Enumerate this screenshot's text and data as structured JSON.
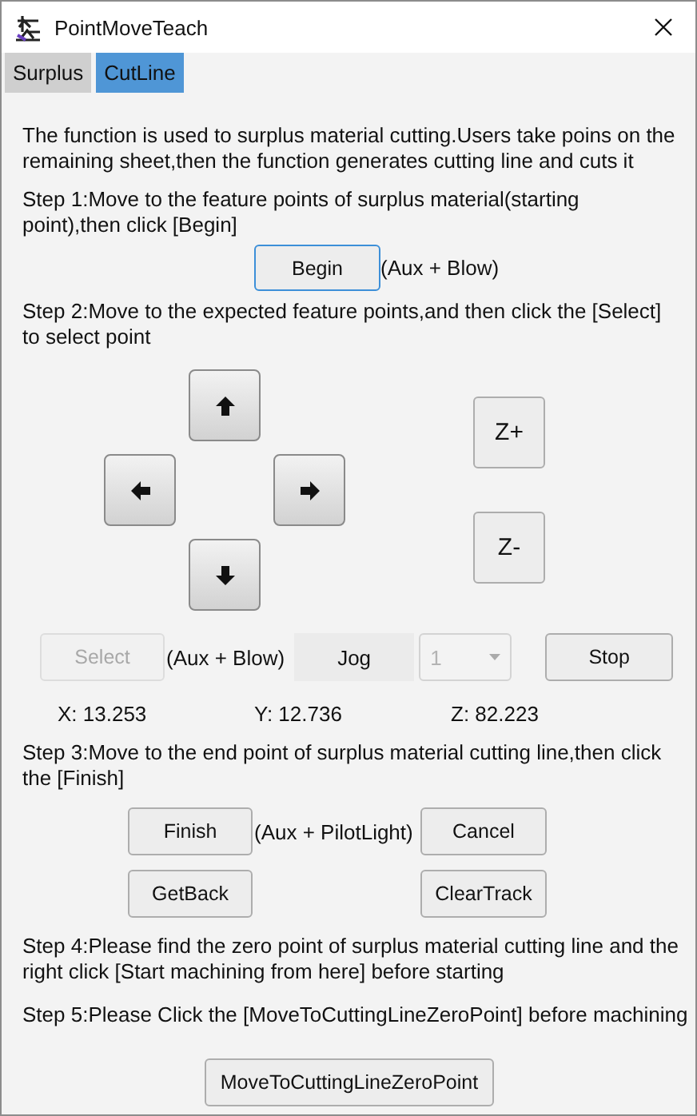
{
  "window": {
    "title": "PointMoveTeach"
  },
  "tabs": [
    {
      "label": "Surplus",
      "selected": false
    },
    {
      "label": "CutLine",
      "selected": true
    }
  ],
  "intro": "The function is used to surplus material cutting.Users take poins on the remaining sheet,then the function generates cutting line and cuts it",
  "step1": {
    "text": "Step 1:Move to the feature points of surplus material(starting point),then click [Begin]",
    "button": "Begin",
    "hint": "(Aux + Blow)"
  },
  "step2": {
    "text": "Step 2:Move to the expected feature points,and then click the [Select] to select point",
    "z_buttons": [
      "Z+",
      "Z-"
    ],
    "select": {
      "label": "Select",
      "disabled": true
    },
    "select_hint": "(Aux + Blow)",
    "jog": "Jog",
    "speed": {
      "value": "1",
      "disabled": true
    },
    "stop": "Stop"
  },
  "coordinates": [
    "X: 13.253",
    "Y: 12.736",
    "Z: 82.223"
  ],
  "step3": {
    "text": "Step 3:Move to the end point of surplus material cutting line,then click the [Finish]",
    "finish": "Finish",
    "hint": "(Aux + PilotLight)",
    "cancel": "Cancel",
    "get_back": "GetBack",
    "clear_track": "ClearTrack"
  },
  "step4": {
    "lines": [
      "Step 4:Please find the zero point of surplus material cutting line and the",
      "right click [Start machining from here] before starting"
    ]
  },
  "step5": "Step 5:Please Click the [MoveToCuttingLineZeroPoint] before machining",
  "zero_button": "MoveToCuttingLineZeroPoint"
}
